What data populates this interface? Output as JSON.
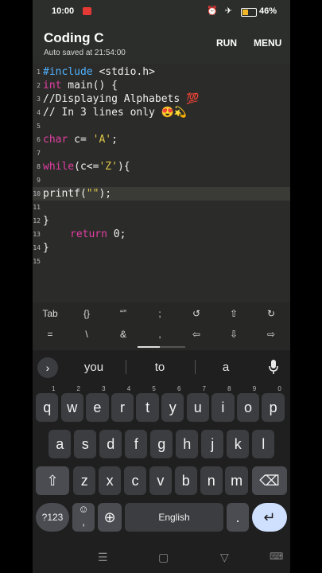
{
  "status": {
    "time": "10:00",
    "icons": "⏰ ✈",
    "battery_pct": "46%",
    "battery_level": 0.46
  },
  "app": {
    "title": "Coding C",
    "subtitle": "Auto saved at 21:54:00",
    "run_label": "RUN",
    "menu_label": "MENU"
  },
  "editor": {
    "line_numbers": [
      "1",
      "2",
      "3",
      "4",
      "5",
      "6",
      "7",
      "8",
      "9",
      "10",
      "11",
      "12",
      "13",
      "14",
      "15"
    ],
    "code": {
      "l1_kw": "#include",
      "l1_rest": " <stdio.h>",
      "l2_kw": "int",
      "l2_rest": " main() {",
      "l3": "//Displaying Alphabets 💯",
      "l4": "// In 3 lines only 😍💫",
      "l6_kw": "char",
      "l6_rest": " c= ",
      "l6_str": "'A'",
      "l6_end": ";",
      "l8_kw": "while",
      "l8_a": "(c<=",
      "l8_str": "'Z'",
      "l8_b": "){",
      "l10_a": "printf(",
      "l10_str": "\"\"",
      "l10_b": ");",
      "l12": "}",
      "l13_kw": "return",
      "l13_rest": " 0;",
      "l14": "}"
    }
  },
  "extra_keys": {
    "row1": [
      "Tab",
      "{}",
      "“”",
      ";",
      "↺",
      "⇧",
      "↻"
    ],
    "row2": [
      "=",
      "\\",
      "&",
      ",",
      "⇦",
      "⇩",
      "⇨"
    ]
  },
  "suggestions": {
    "chevron": "›",
    "words": [
      "you",
      "to",
      "a"
    ]
  },
  "keyboard": {
    "row1": [
      "q",
      "w",
      "e",
      "r",
      "t",
      "y",
      "u",
      "i",
      "o",
      "p"
    ],
    "row1_hints": [
      "1",
      "2",
      "3",
      "4",
      "5",
      "6",
      "7",
      "8",
      "9",
      "0"
    ],
    "row2": [
      "a",
      "s",
      "d",
      "f",
      "g",
      "h",
      "j",
      "k",
      "l"
    ],
    "row3": [
      "z",
      "x",
      "c",
      "v",
      "b",
      "n",
      "m"
    ],
    "shift": "⇧",
    "backspace": "⌫",
    "symbols": "?123",
    "emoji": "☺",
    "comma": ",",
    "globe": "⊕",
    "space": "English",
    "period": ".",
    "enter": "↵"
  },
  "nav": {
    "recents": "☰",
    "home": "▢",
    "back": "▽",
    "keyboard": "⌨"
  }
}
